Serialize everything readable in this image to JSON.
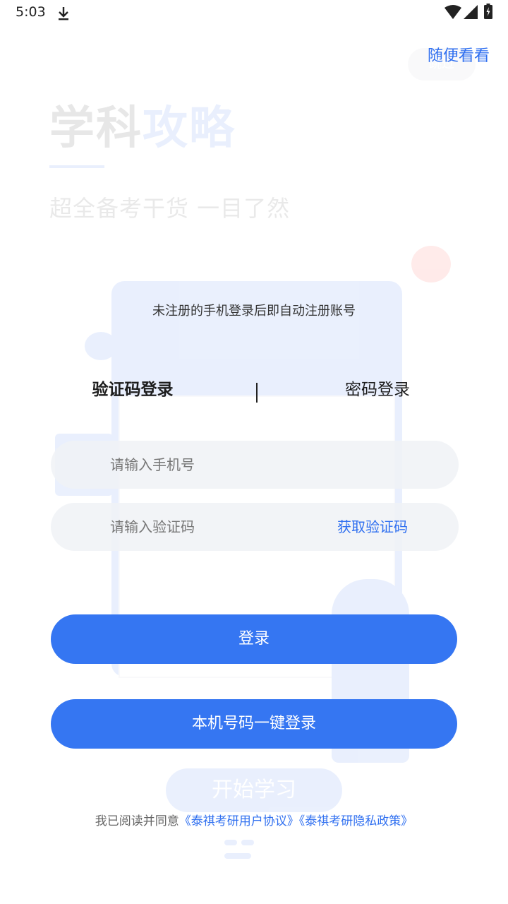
{
  "status_bar": {
    "time": "5:03",
    "icons": [
      "download-icon",
      "wifi-icon",
      "signal-icon",
      "battery-charging-icon"
    ]
  },
  "background": {
    "skip_pill": "跳过",
    "title_plain": "学科",
    "title_accent": "攻略",
    "subtitle": "超全备考干货 一目了然",
    "start_button": "开始学习"
  },
  "header": {
    "skip_label": "随便看看"
  },
  "login": {
    "hint": "未注册的手机登录后即自动注册账号",
    "tabs": [
      {
        "label": "验证码登录",
        "active": true
      },
      {
        "label": "密码登录",
        "active": false
      }
    ],
    "phone_placeholder": "请输入手机号",
    "code_placeholder": "请输入验证码",
    "get_code_label": "获取验证码",
    "login_button": "登录",
    "one_key_button": "本机号码一键登录"
  },
  "agreement": {
    "prefix": "我已阅读并同意",
    "user_agreement": "《泰祺考研用户协议》",
    "privacy_policy": "《泰祺考研隐私政策》"
  },
  "colors": {
    "accent": "#2f6ff0",
    "button": "#3576f2"
  }
}
